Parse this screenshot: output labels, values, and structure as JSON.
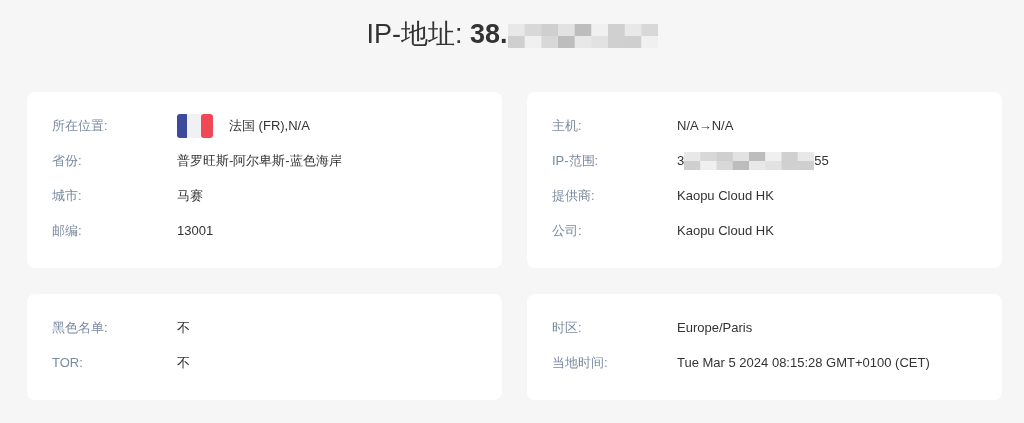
{
  "title": {
    "label": "IP-地址:",
    "value": "38.",
    "redacted": true
  },
  "cards": [
    {
      "rows": [
        {
          "label": "所在位置:",
          "value": "法国 (FR),N/A",
          "kind": "flag"
        },
        {
          "label": "省份:",
          "value": "普罗旺斯-阿尔卑斯-蓝色海岸",
          "kind": "text"
        },
        {
          "label": "城市:",
          "value": "马赛",
          "kind": "text"
        },
        {
          "label": "邮编:",
          "value": "13001",
          "kind": "text"
        }
      ]
    },
    {
      "rows": [
        {
          "label": "主机:",
          "value": "N/A→N/A",
          "kind": "text"
        },
        {
          "label": "IP-范围:",
          "prefix": "3",
          "suffix": "55",
          "kind": "redacted"
        },
        {
          "label": "提供商:",
          "value": "Kaopu Cloud HK",
          "kind": "text"
        },
        {
          "label": "公司:",
          "value": "Kaopu Cloud HK",
          "kind": "text"
        }
      ]
    },
    {
      "rows": [
        {
          "label": "黑色名单:",
          "value": "不",
          "kind": "text"
        },
        {
          "label": "TOR:",
          "value": "不",
          "kind": "text"
        }
      ]
    },
    {
      "rows": [
        {
          "label": "时区:",
          "value": "Europe/Paris",
          "kind": "text"
        },
        {
          "label": "当地时间:",
          "value": "Tue Mar 5 2024 08:15:28 GMT+0100 (CET)",
          "kind": "text"
        }
      ]
    }
  ]
}
